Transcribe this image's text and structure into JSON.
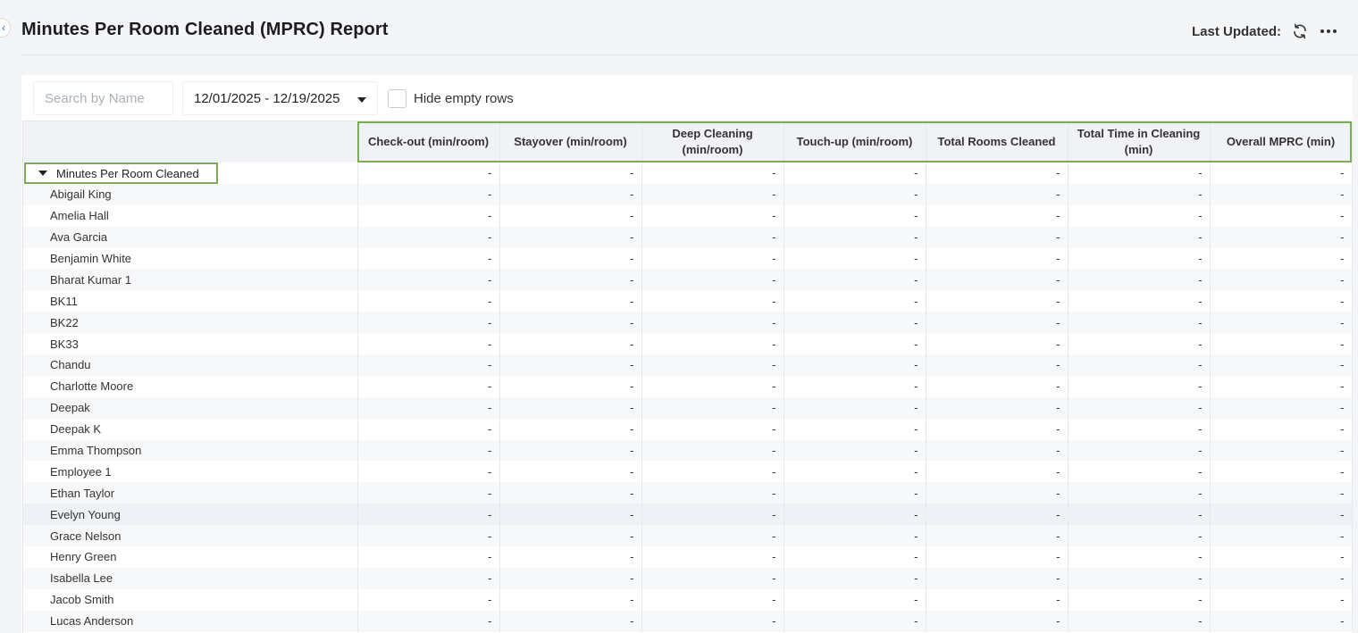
{
  "header": {
    "title": "Minutes Per Room Cleaned (MPRC) Report",
    "last_updated_label": "Last Updated:"
  },
  "toolbar": {
    "search_placeholder": "Search by Name",
    "date_range": "12/01/2025 - 12/19/2025",
    "hide_empty_label": "Hide empty rows",
    "hide_empty_checked": false
  },
  "table": {
    "columns": [
      "Check-out (min/room)",
      "Stayover (min/room)",
      "Deep Cleaning (min/room)",
      "Touch-up (min/room)",
      "Total Rooms Cleaned",
      "Total Time in Cleaning (min)",
      "Overall MPRC (min)"
    ],
    "group_label": "Minutes Per Room Cleaned",
    "rows": [
      {
        "name": "Abigail King",
        "values": [
          "-",
          "-",
          "-",
          "-",
          "-",
          "-",
          "-"
        ]
      },
      {
        "name": "Amelia Hall",
        "values": [
          "-",
          "-",
          "-",
          "-",
          "-",
          "-",
          "-"
        ]
      },
      {
        "name": "Ava Garcia",
        "values": [
          "-",
          "-",
          "-",
          "-",
          "-",
          "-",
          "-"
        ]
      },
      {
        "name": "Benjamin White",
        "values": [
          "-",
          "-",
          "-",
          "-",
          "-",
          "-",
          "-"
        ]
      },
      {
        "name": "Bharat Kumar 1",
        "values": [
          "-",
          "-",
          "-",
          "-",
          "-",
          "-",
          "-"
        ]
      },
      {
        "name": "BK11",
        "values": [
          "-",
          "-",
          "-",
          "-",
          "-",
          "-",
          "-"
        ]
      },
      {
        "name": "BK22",
        "values": [
          "-",
          "-",
          "-",
          "-",
          "-",
          "-",
          "-"
        ]
      },
      {
        "name": "BK33",
        "values": [
          "-",
          "-",
          "-",
          "-",
          "-",
          "-",
          "-"
        ]
      },
      {
        "name": "Chandu",
        "values": [
          "-",
          "-",
          "-",
          "-",
          "-",
          "-",
          "-"
        ]
      },
      {
        "name": "Charlotte Moore",
        "values": [
          "-",
          "-",
          "-",
          "-",
          "-",
          "-",
          "-"
        ]
      },
      {
        "name": "Deepak",
        "values": [
          "-",
          "-",
          "-",
          "-",
          "-",
          "-",
          "-"
        ]
      },
      {
        "name": "Deepak K",
        "values": [
          "-",
          "-",
          "-",
          "-",
          "-",
          "-",
          "-"
        ]
      },
      {
        "name": "Emma Thompson",
        "values": [
          "-",
          "-",
          "-",
          "-",
          "-",
          "-",
          "-"
        ]
      },
      {
        "name": "Employee 1",
        "values": [
          "-",
          "-",
          "-",
          "-",
          "-",
          "-",
          "-"
        ]
      },
      {
        "name": "Ethan Taylor",
        "values": [
          "-",
          "-",
          "-",
          "-",
          "-",
          "-",
          "-"
        ]
      },
      {
        "name": "Evelyn Young",
        "values": [
          "-",
          "-",
          "-",
          "-",
          "-",
          "-",
          "-"
        ]
      },
      {
        "name": "Grace Nelson",
        "values": [
          "-",
          "-",
          "-",
          "-",
          "-",
          "-",
          "-"
        ]
      },
      {
        "name": "Henry Green",
        "values": [
          "-",
          "-",
          "-",
          "-",
          "-",
          "-",
          "-"
        ]
      },
      {
        "name": "Isabella Lee",
        "values": [
          "-",
          "-",
          "-",
          "-",
          "-",
          "-",
          "-"
        ]
      },
      {
        "name": "Jacob Smith",
        "values": [
          "-",
          "-",
          "-",
          "-",
          "-",
          "-",
          "-"
        ]
      },
      {
        "name": "Lucas Anderson",
        "values": [
          "-",
          "-",
          "-",
          "-",
          "-",
          "-",
          "-"
        ]
      }
    ],
    "group_values": [
      "-",
      "-",
      "-",
      "-",
      "-",
      "-",
      "-"
    ]
  },
  "icons": {
    "collapse": "chevron-left-icon",
    "refresh": "refresh-icon",
    "more": "more-horizontal-icon",
    "date_caret": "caret-down-icon",
    "group_toggle": "caret-down-icon"
  },
  "colors": {
    "highlight_border": "#7cab5c",
    "accent": "#1a73e8"
  }
}
